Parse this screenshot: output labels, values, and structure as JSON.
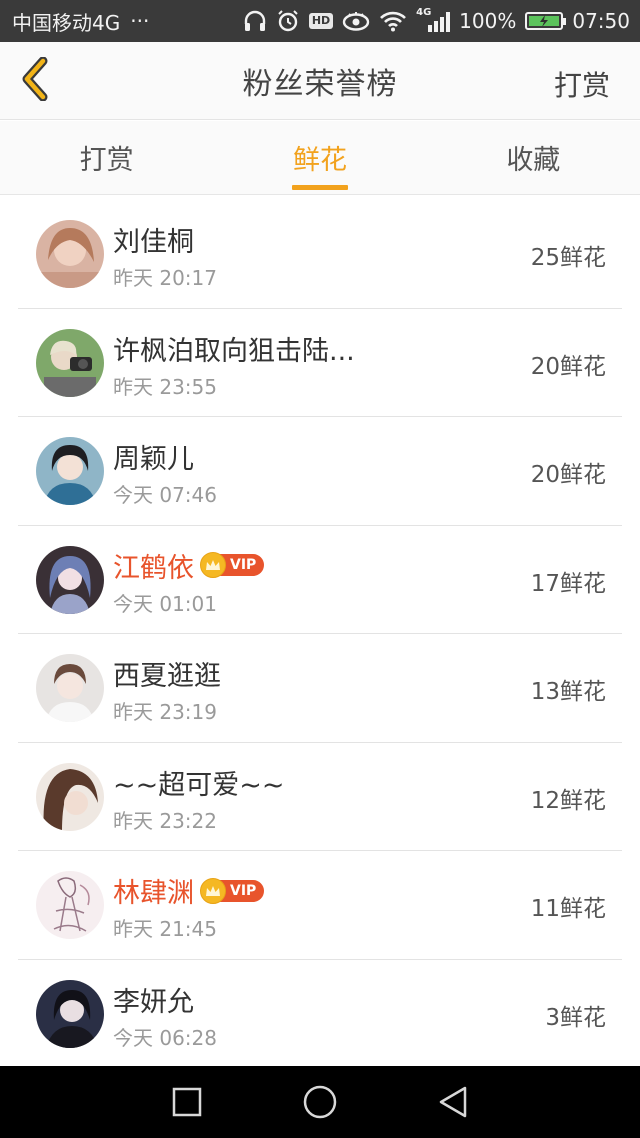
{
  "status_bar": {
    "carrier": "中国移动4G",
    "more": "···",
    "hd": "HD",
    "net_small": "4G",
    "battery": "100%",
    "time": "07:50"
  },
  "header": {
    "title": "粉丝荣誉榜",
    "action": "打赏"
  },
  "tabs": [
    {
      "label": "打赏",
      "active": false
    },
    {
      "label": "鲜花",
      "active": true
    },
    {
      "label": "收藏",
      "active": false
    }
  ],
  "accent_color": "#f2a21d",
  "vip_name_color": "#e8542c",
  "list": [
    {
      "name": "刘佳桐",
      "time": "昨天 20:17",
      "count": "25鲜花",
      "vip": false
    },
    {
      "name": "许枫泊取向狙击陆...",
      "time": "昨天 23:55",
      "count": "20鲜花",
      "vip": false
    },
    {
      "name": "周颖儿",
      "time": "今天 07:46",
      "count": "20鲜花",
      "vip": false
    },
    {
      "name": "江鹤依",
      "time": "今天 01:01",
      "count": "17鲜花",
      "vip": true,
      "vip_label": "VIP"
    },
    {
      "name": "西夏逛逛",
      "time": "昨天 23:19",
      "count": "13鲜花",
      "vip": false
    },
    {
      "name": "~~超可爱~~",
      "time": "昨天 23:22",
      "count": "12鲜花",
      "vip": false
    },
    {
      "name": "林肆渊",
      "time": "昨天 21:45",
      "count": "11鲜花",
      "vip": true,
      "vip_label": "VIP"
    },
    {
      "name": "李妍允",
      "time": "今天 06:28",
      "count": "3鲜花",
      "vip": false
    }
  ],
  "icons": {
    "back": "chevron-left-icon",
    "nav": [
      "square-recents-icon",
      "circle-home-icon",
      "triangle-back-icon"
    ]
  }
}
